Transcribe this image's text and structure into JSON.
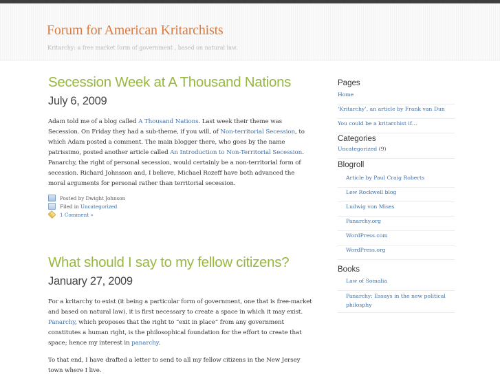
{
  "site": {
    "title": "Forum for American Kritarchists",
    "tagline": "Kritarchy: a free market form of government , based on natural law."
  },
  "posts": [
    {
      "title": "Secession Week at A Thousand Nations",
      "date": "July 6, 2009",
      "p1": {
        "t1": "Adam told me of a blog called ",
        "l1": "A Thousand Nations",
        "t2": ". Last week their theme was Secession. On Friday they had a sub-theme, if you will, of ",
        "l2": "Non-territorial Secession",
        "t3": ", to which Adam posted a comment. The main blogger there, who goes by the name patrissimo, posted another article called ",
        "l3": "An Introduction to Non-Territorial Secession",
        "t4": ". Panarchy, the right of personal secession, would certainly be a non-territorial form of secession. Richard Johnsson and, I believe, Michael Rozeff have both advanced the moral arguments for personal rather than territorial secession."
      },
      "meta": {
        "author": "Posted by Dwight Johnson",
        "filed_prefix": "Filed in ",
        "category": "Uncategorized",
        "comments": "1 Comment »"
      }
    },
    {
      "title": "What should I say to my fellow citizens?",
      "date": "January 27, 2009",
      "p1": {
        "t1": "For a kritarchy to exist (it being a particular form of government, one that is free-market and based on natural law), it is first necessary to create a space in which it may exist. ",
        "l1": "Panarchy",
        "t2": ", which proposes that the right to “exit in place” from any government constitutes a human right, is the philosophical foundation for the effort to create that space; hence my interest in ",
        "l2": "panarchy",
        "t3": "."
      },
      "p2": "To that end, I have drafted a letter to send to all my fellow citizens in the New Jersey town where I live."
    }
  ],
  "sidebar": {
    "pages_heading": "Pages",
    "pages": [
      "Home",
      "‘Kritarchy’, an article by Frank van Dun",
      "You could be a kritarchist if…"
    ],
    "categories_heading": "Categories",
    "categories": [
      {
        "label": "Uncategorized",
        "count": " (9)"
      }
    ],
    "blogroll_heading": "Blogroll",
    "blogroll": [
      "Article by Paul Craig Roberts",
      "Lew Rockwell blog",
      "Ludwig von Mises",
      "Panarchy.org",
      "WordPress.com",
      "WordPress.org"
    ],
    "books_heading": "Books",
    "books": [
      "Law of Somalia",
      "Panarchy: Essays in the new political philosphy"
    ]
  }
}
